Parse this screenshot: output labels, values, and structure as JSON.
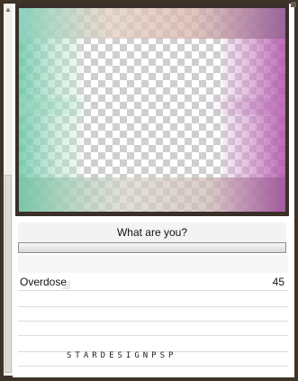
{
  "preview": {
    "description_icon": "checkerboard-transparency"
  },
  "prompt": {
    "question": "What are you?",
    "bar_progress": 1.0
  },
  "setting": {
    "label": "Overdose",
    "value": "45"
  },
  "watermark": {
    "text": "STARDESIGNPSP"
  },
  "colors": {
    "frame_bg": "#3d3427",
    "panel_bg": "#ffffff",
    "preview_dark_border": "#3b2f2a"
  }
}
